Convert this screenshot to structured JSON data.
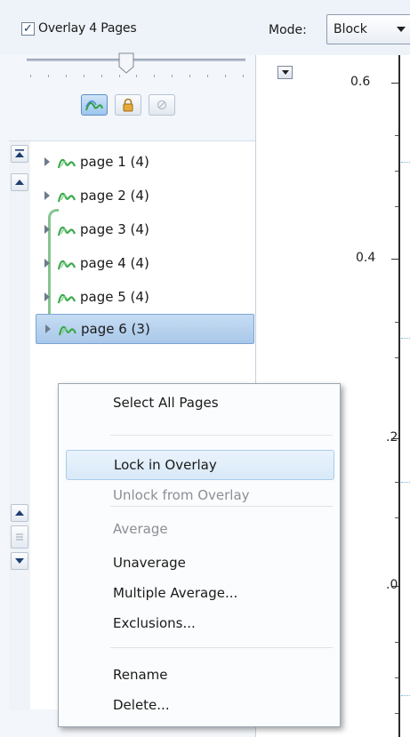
{
  "header": {
    "overlay_checkbox_checked": true,
    "overlay_label": "Overlay 4 Pages",
    "mode_label": "Mode:",
    "mode_value": "Block"
  },
  "slider": {
    "value_fraction": 0.35
  },
  "toolbar": {
    "buttons": [
      {
        "icon": "overlay-wave-icon",
        "active": true
      },
      {
        "icon": "lock-icon",
        "active": false
      },
      {
        "icon": "unlock-icon",
        "active": false
      }
    ]
  },
  "tree": {
    "pages": [
      {
        "label": "page 1 (4)",
        "selected": false,
        "overlaid": false
      },
      {
        "label": "page 2 (4)",
        "selected": false,
        "overlaid": false
      },
      {
        "label": "page 3 (4)",
        "selected": false,
        "overlaid": true
      },
      {
        "label": "page 4 (4)",
        "selected": false,
        "overlaid": true
      },
      {
        "label": "page 5 (4)",
        "selected": false,
        "overlaid": true
      },
      {
        "label": "page 6 (3)",
        "selected": true,
        "overlaid": true
      }
    ]
  },
  "chart": {
    "y_ticks": [
      "0.6",
      "0.4",
      ".2",
      ".0"
    ]
  },
  "context_menu": {
    "items": [
      {
        "label": "Select All Pages",
        "disabled": false,
        "hover": false
      },
      {
        "label": "Lock in Overlay",
        "disabled": false,
        "hover": true
      },
      {
        "label": "Unlock from Overlay",
        "disabled": true,
        "hover": false
      },
      {
        "label": "Average",
        "disabled": true,
        "hover": false
      },
      {
        "label": "Unaverage",
        "disabled": false,
        "hover": false
      },
      {
        "label": "Multiple Average...",
        "disabled": false,
        "hover": false
      },
      {
        "label": "Exclusions...",
        "disabled": false,
        "hover": false
      },
      {
        "label": "Rename",
        "disabled": false,
        "hover": false
      },
      {
        "label": "Delete...",
        "disabled": false,
        "hover": false
      }
    ]
  },
  "colors": {
    "selection": "#a9c8ea",
    "overlay_bracket": "#86c48f",
    "wave_icon": "#3aa84a"
  }
}
